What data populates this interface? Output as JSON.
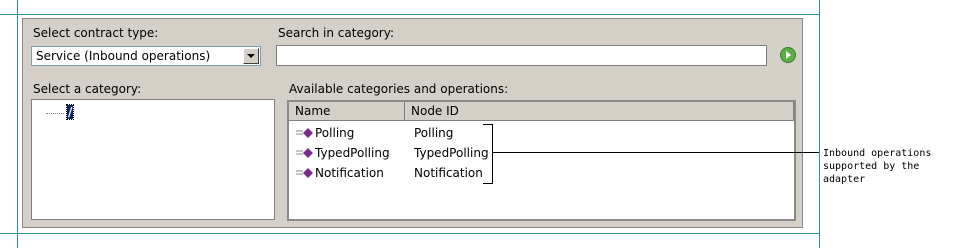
{
  "contract_type": {
    "label": "Select contract type:",
    "selected": "Service (Inbound operations)"
  },
  "search": {
    "label": "Search in category:",
    "value": "",
    "go_icon": "go-arrow-icon"
  },
  "category_tree": {
    "label": "Select a category:",
    "root_node": "/"
  },
  "operations": {
    "label": "Available categories and operations:",
    "columns": [
      "Name",
      "Node ID"
    ],
    "rows": [
      {
        "name": "Polling",
        "node_id": "Polling"
      },
      {
        "name": "TypedPolling",
        "node_id": "TypedPolling"
      },
      {
        "name": "Notification",
        "node_id": "Notification"
      }
    ],
    "row_icon": "operation-icon"
  },
  "annotation": {
    "line1": "Inbound operations",
    "line2": "supported by the adapter"
  },
  "colors": {
    "panel_bg": "#d4d0c8",
    "selection": "#0a246a",
    "guide_lines": "#2a8fa8",
    "icon_purple": "#7b2d8e",
    "go_green": "#5cae44"
  }
}
